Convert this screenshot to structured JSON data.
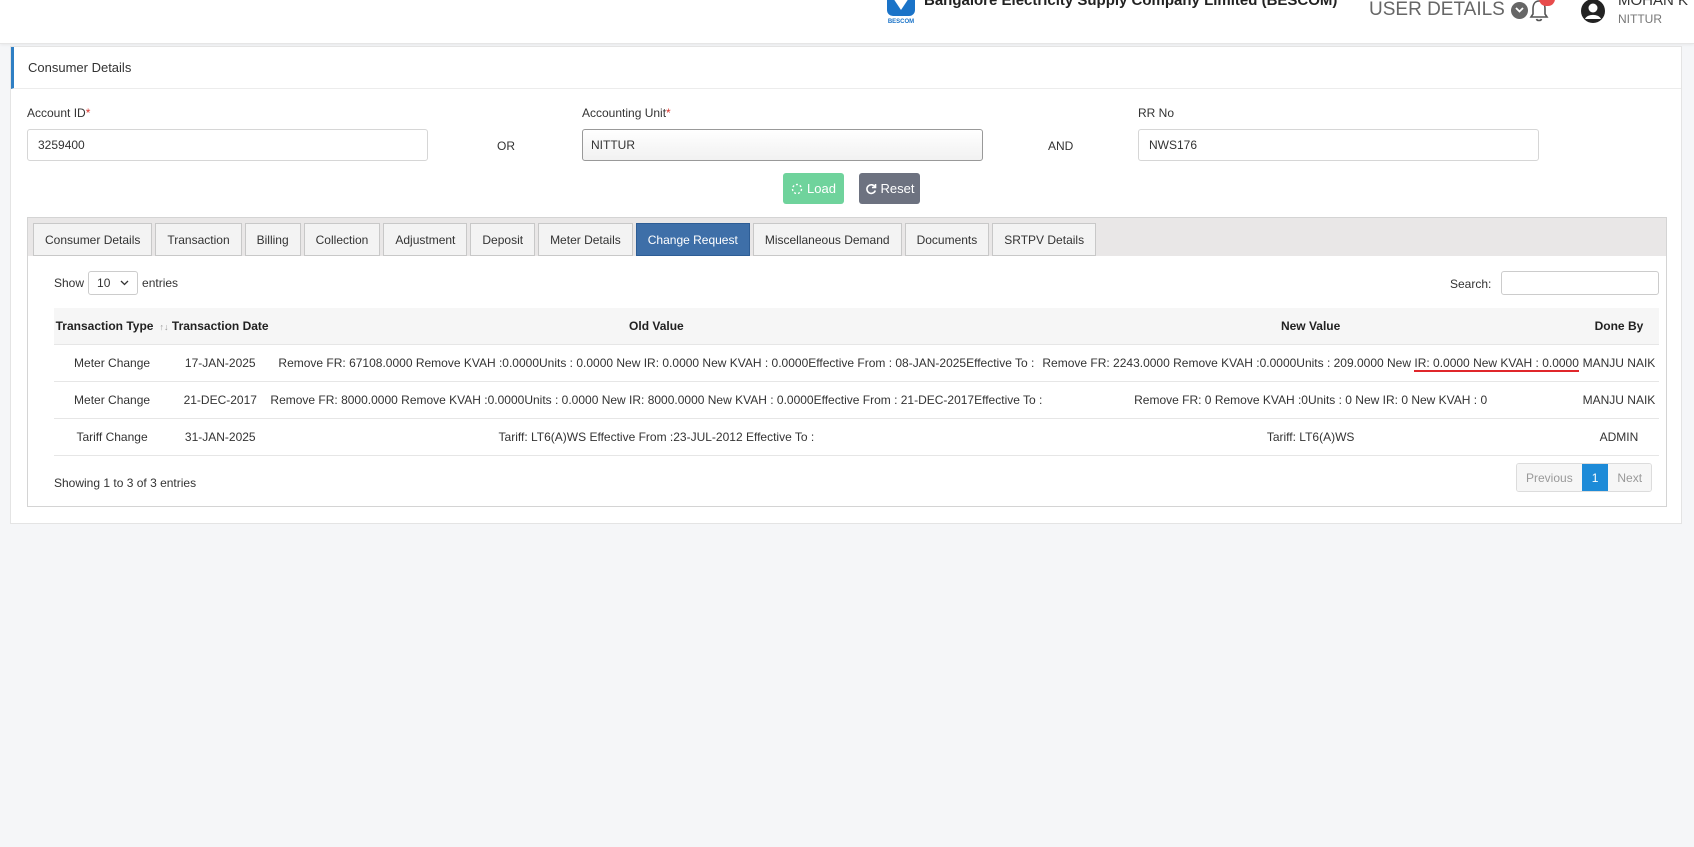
{
  "header": {
    "company": "Bangalore Electricity Supply Company Limited (BESCOM)",
    "logo_text": "BESCOM",
    "user_details_label": "USER DETAILS",
    "user_name": "MOHAN K",
    "user_unit": "NITTUR"
  },
  "panel": {
    "title": "Consumer Details",
    "account_id_label": "Account ID",
    "account_id_value": "3259400",
    "or_label": "OR",
    "accounting_unit_label": "Accounting Unit",
    "accounting_unit_value": "NITTUR",
    "and_label": "AND",
    "rr_no_label": "RR No",
    "rr_no_value": "NWS176",
    "required_mark": "*",
    "load_label": "Load",
    "reset_label": "Reset"
  },
  "tabs": [
    {
      "label": "Consumer Details"
    },
    {
      "label": "Transaction"
    },
    {
      "label": "Billing"
    },
    {
      "label": "Collection"
    },
    {
      "label": "Adjustment"
    },
    {
      "label": "Deposit"
    },
    {
      "label": "Meter Details"
    },
    {
      "label": "Change Request"
    },
    {
      "label": "Miscellaneous Demand"
    },
    {
      "label": "Documents"
    },
    {
      "label": "SRTPV Details"
    }
  ],
  "table_controls": {
    "show_label": "Show",
    "entries_value": "10",
    "entries_label": "entries",
    "search_label": "Search:"
  },
  "table": {
    "columns": [
      "Transaction Type",
      "Transaction Date",
      "Old Value",
      "New Value",
      "Done By"
    ],
    "rows": [
      {
        "type": "Meter Change",
        "date": "17-JAN-2025",
        "old": "Remove FR: 67108.0000 Remove KVAH :0.0000Units : 0.0000 New IR: 0.0000 New KVAH : 0.0000Effective From : 08-JAN-2025Effective To :",
        "new_prefix": "Remove FR: 2243.0000 Remove KVAH :0.0000Units : 209.0000 New ",
        "new_highlight": "IR: 0.0000 New KVAH : 0.0000",
        "by": "MANJU NAIK"
      },
      {
        "type": "Meter Change",
        "date": "21-DEC-2017",
        "old": "Remove FR: 8000.0000 Remove KVAH :0.0000Units : 0.0000 New IR: 8000.0000 New KVAH : 0.0000Effective From : 21-DEC-2017Effective To :",
        "new": "Remove FR: 0 Remove KVAH :0Units : 0 New IR: 0 New KVAH : 0",
        "by": "MANJU NAIK"
      },
      {
        "type": "Tariff Change",
        "date": "31-JAN-2025",
        "old": "Tariff: LT6(A)WS Effective From :23-JUL-2012 Effective To :",
        "new": "Tariff: LT6(A)WS",
        "by": "ADMIN"
      }
    ],
    "showing_text": "Showing 1 to 3 of 3 entries"
  },
  "pagination": {
    "previous": "Previous",
    "current": "1",
    "next": "Next"
  },
  "colors": {
    "active_tab": "#3e6fa8",
    "load_button": "#6fd39c",
    "reset_button": "#6d7280",
    "page_active": "#1d8bd8",
    "highlight_underline": "#e0262b"
  }
}
